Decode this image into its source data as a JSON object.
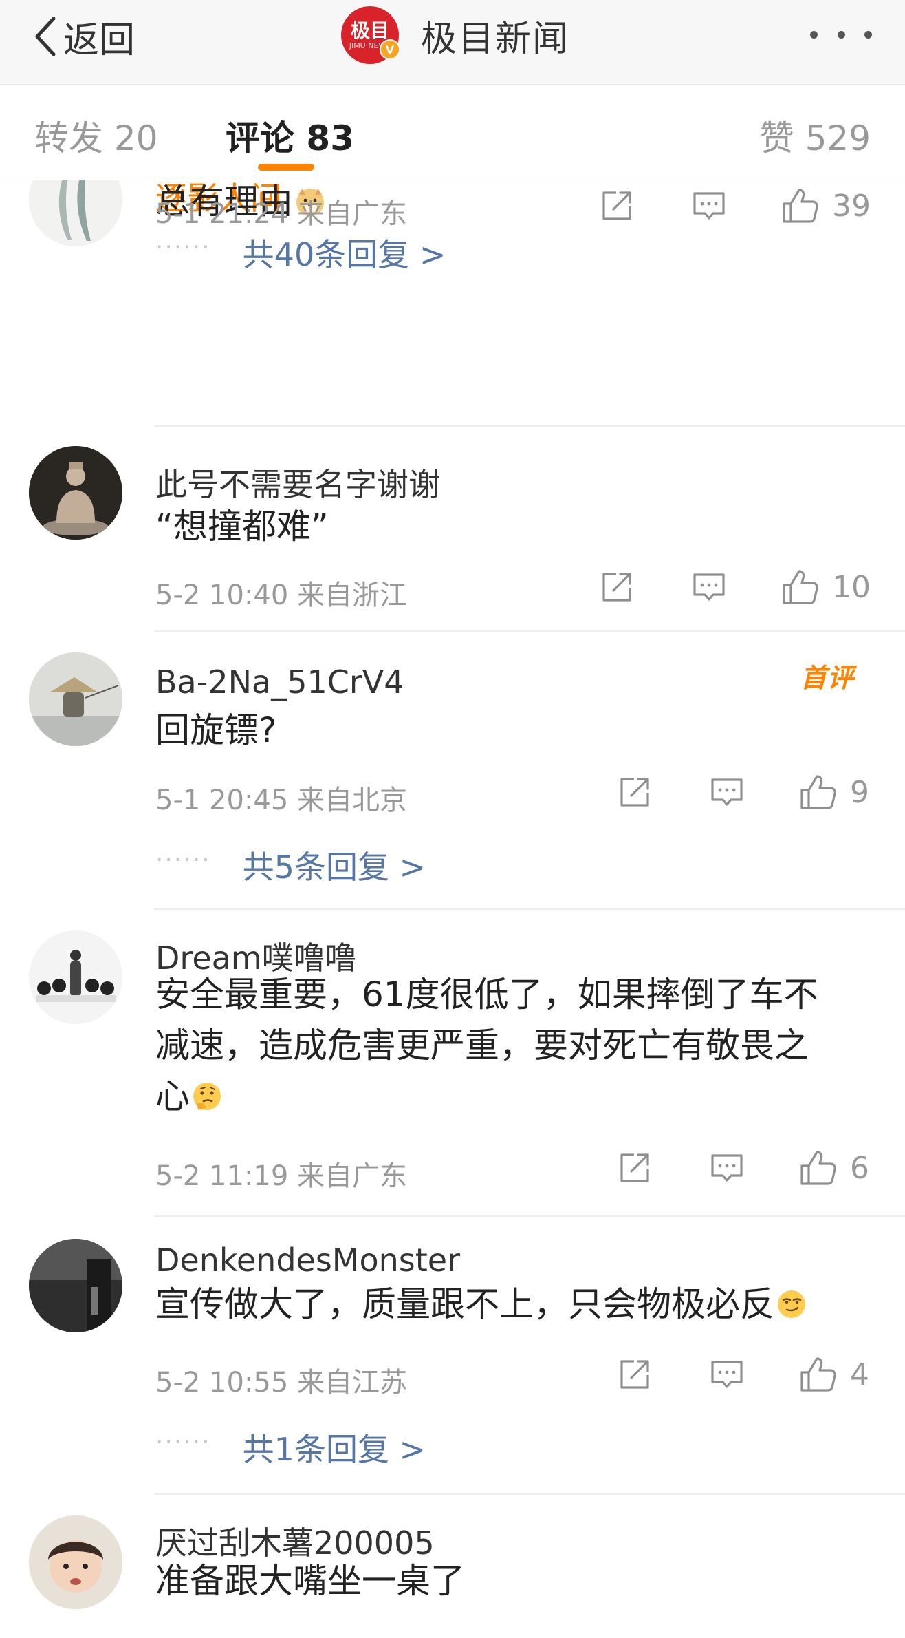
{
  "nav": {
    "back_label": "返回",
    "logo_text": "极目",
    "logo_subtext": "JIMU NEWS",
    "logo_badge": "V",
    "title": "极目新闻",
    "icons": [
      "back-chevron-icon",
      "more-dots-icon"
    ]
  },
  "tabs": {
    "repost": "转发 20",
    "comments": "评论 83",
    "likes": "赞 529",
    "active": "comments",
    "accent_color": "#ff8200"
  },
  "comments": [
    {
      "username": "逐影人间",
      "text": "总有理由",
      "emoji": "doge-emoji",
      "time": "5-1 21:24 来自广东",
      "likes": "39",
      "replies": "共40条回复 >"
    },
    {
      "username": "此号不需要名字谢谢",
      "text": "“想撞都难”",
      "time": "5-2 10:40 来自浙江",
      "likes": "10"
    },
    {
      "username": "Ba-2Na_51CrV4",
      "badge": "首评",
      "text": "回旋镖?",
      "time": "5-1 20:45 来自北京",
      "likes": "9",
      "replies": "共5条回复 >"
    },
    {
      "username": "Dream噗噜噜",
      "text_lines": [
        "安全最重要，61度很低了，如果摔倒了车不",
        "减速，造成危害更严重，要对死亡有敬畏之",
        "心"
      ],
      "emoji": "thinking-emoji",
      "time": "5-2 11:19 来自广东",
      "likes": "6"
    },
    {
      "username": "DenkendesMonster",
      "text": "宣传做大了，质量跟不上，只会物极必反",
      "emoji": "smirk-emoji",
      "time": "5-2 10:55 来自江苏",
      "likes": "4",
      "replies": "共1条回复 >"
    },
    {
      "username": "厌过刮木薯200005",
      "text": "准备跟大嘴坐一桌了"
    }
  ],
  "reply_dots": "······",
  "colors": {
    "reply_link": "#5576a6",
    "meta_gray": "#999999",
    "nav_bg": "#f7f7f7"
  }
}
